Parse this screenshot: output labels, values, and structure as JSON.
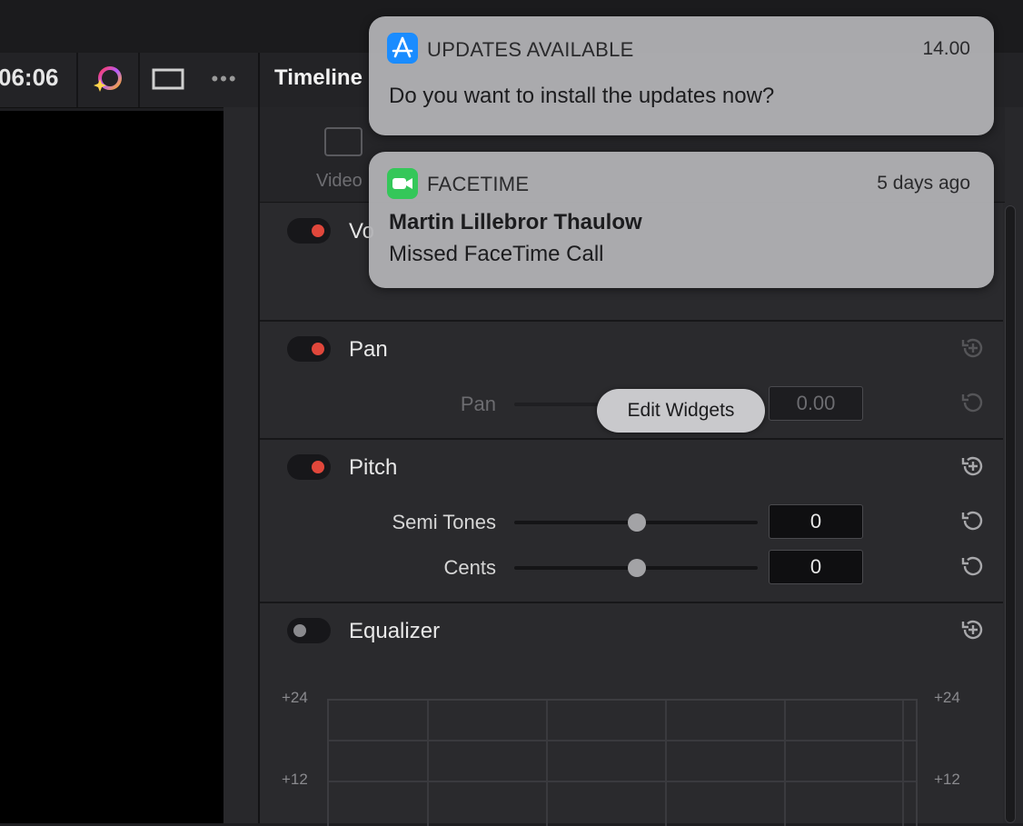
{
  "app": {
    "timecode": "06:06",
    "panel_title": "Timeline",
    "tab_video_label": "Video"
  },
  "sections": {
    "volume": {
      "title": "Vo",
      "enabled": true
    },
    "pan": {
      "title": "Pan",
      "enabled": true,
      "param_label": "Pan",
      "value": "0.00"
    },
    "pitch": {
      "title": "Pitch",
      "enabled": true,
      "semi_tones_label": "Semi Tones",
      "semi_tones_value": "0",
      "cents_label": "Cents",
      "cents_value": "0"
    },
    "equalizer": {
      "title": "Equalizer",
      "enabled": false,
      "scale_labels": [
        "+24",
        "+12"
      ]
    }
  },
  "notifications": [
    {
      "app_name": "UPDATES AVAILABLE",
      "time": "14.00",
      "body": "Do you want to install the updates now?",
      "icon": "app-store-icon"
    },
    {
      "app_name": "FACETIME",
      "time": "5 days ago",
      "title": "Martin Lillebror Thaulow",
      "body": "Missed FaceTime Call",
      "icon": "facetime-icon"
    }
  ],
  "edit_widgets_label": "Edit Widgets",
  "colors": {
    "toggle_on": "#e0473b",
    "app_store_blue": "#1a8cff",
    "facetime_green": "#34c759"
  }
}
